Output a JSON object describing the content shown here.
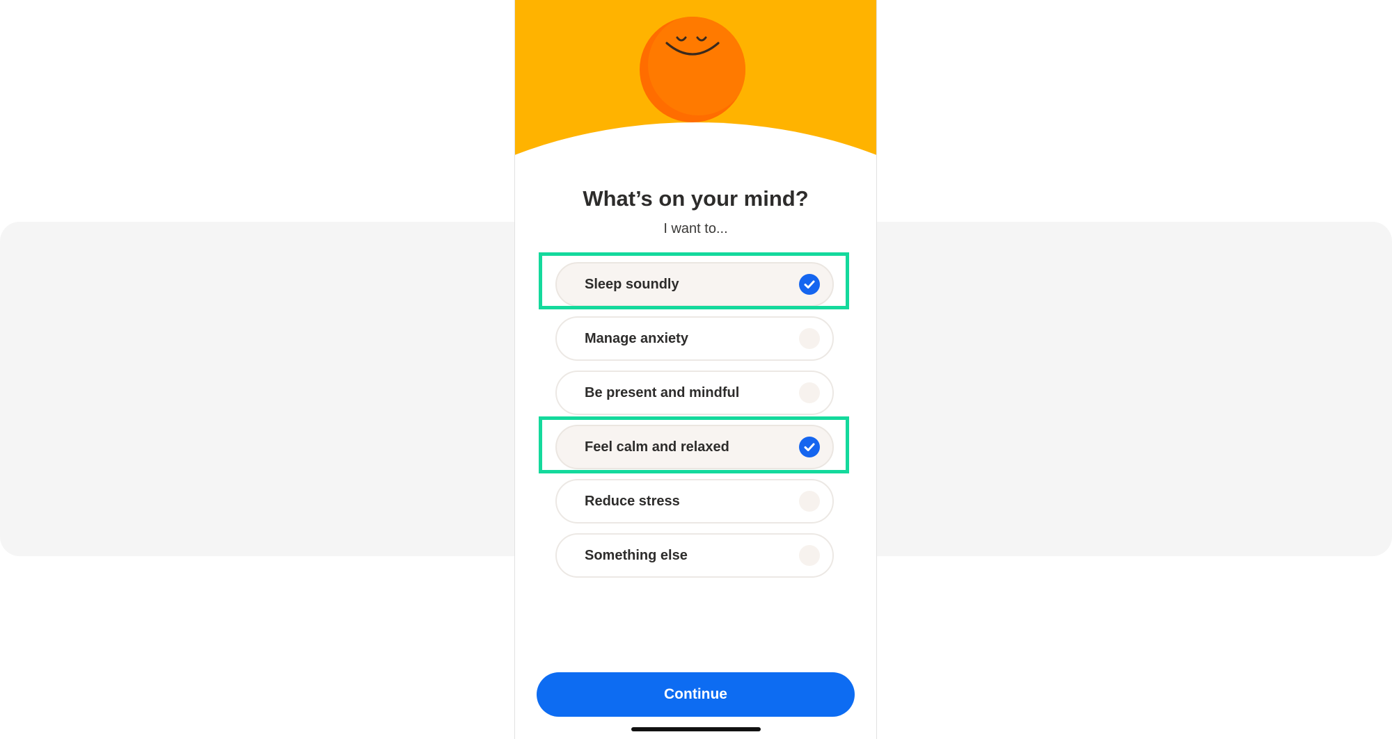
{
  "screen": {
    "title": "What’s on your mind?",
    "subtitle": "I want to..."
  },
  "options": [
    {
      "label": "Sleep soundly",
      "selected": true
    },
    {
      "label": "Manage anxiety",
      "selected": false
    },
    {
      "label": "Be present and mindful",
      "selected": false
    },
    {
      "label": "Feel calm and relaxed",
      "selected": true
    },
    {
      "label": "Reduce stress",
      "selected": false
    },
    {
      "label": "Something else",
      "selected": false
    }
  ],
  "continue_label": "Continue",
  "icons": {
    "mascot": "smiling-sun-icon",
    "selected_mark": "check-circle-icon"
  },
  "colors": {
    "hero_background": "#ffb300",
    "mascot": "#ff7a00",
    "accent_blue": "#0d6cf2",
    "highlight": "#14d99c"
  }
}
